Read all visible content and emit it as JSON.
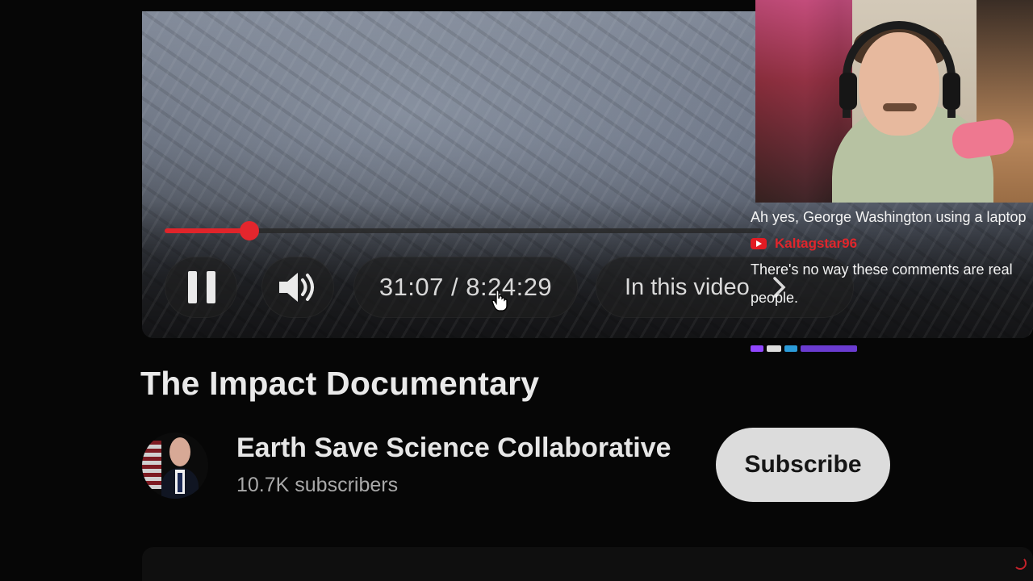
{
  "player": {
    "progress_fraction": 0.0628,
    "time_display": "31:07 / 8:24:29",
    "chapter_label": "In this video",
    "state": "playing",
    "accent_color": "#e0242a"
  },
  "icons": {
    "pause": "pause-icon",
    "volume": "volume-icon",
    "chevron": "chevron-right-icon",
    "cursor": "hand-cursor-icon"
  },
  "chat": {
    "messages": [
      {
        "text": "Ah yes, George Washington using a laptop"
      },
      {
        "platform": "youtube",
        "username": "Kaltagstar96",
        "text": "There's no way these comments are real people."
      }
    ]
  },
  "video": {
    "title": "The Impact Documentary",
    "channel_name": "Earth Save Science Collaborative",
    "subscribers": "10.7K subscribers",
    "subscribe_label": "Subscribe"
  }
}
